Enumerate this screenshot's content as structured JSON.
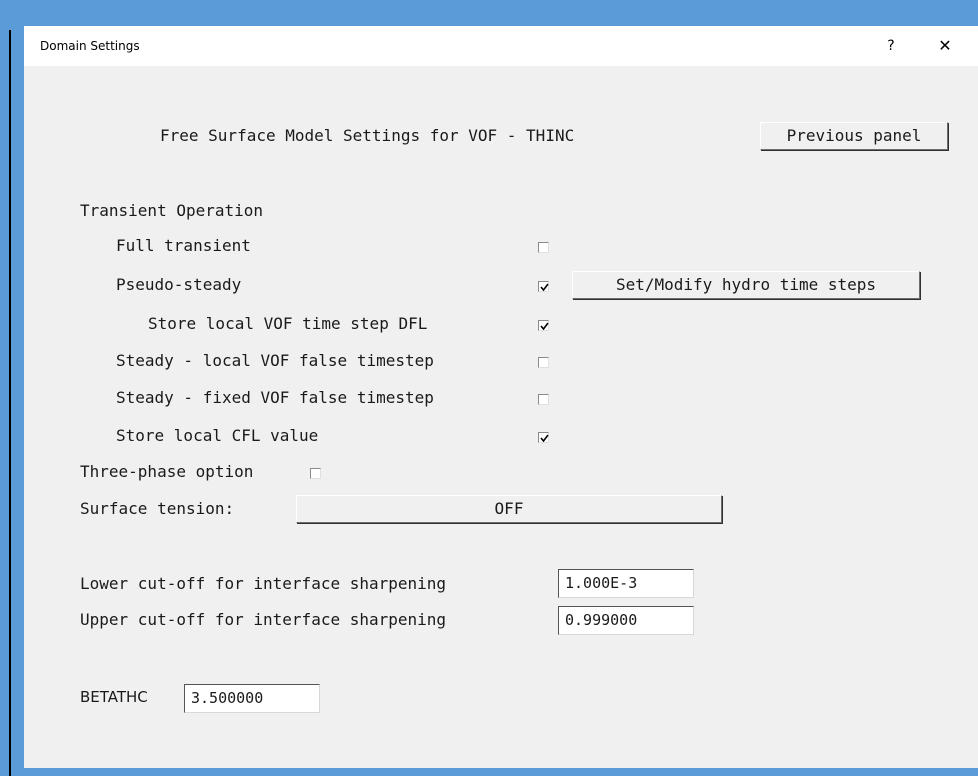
{
  "window": {
    "title": "Domain Settings",
    "help_label": "?",
    "close_label": "✕"
  },
  "panel": {
    "heading": "Free Surface Model Settings for VOF - THINC",
    "previous_button": "Previous panel"
  },
  "transient": {
    "section_label": "Transient Operation",
    "options": [
      {
        "label": "Full transient",
        "checked": false
      },
      {
        "label": "Pseudo-steady",
        "checked": true
      },
      {
        "label": "Store local VOF time step DFL",
        "checked": true
      },
      {
        "label": "Steady - local VOF false timestep",
        "checked": false
      },
      {
        "label": "Steady - fixed VOF false timestep",
        "checked": false
      },
      {
        "label": "Store local CFL value",
        "checked": true
      }
    ],
    "hydro_button": "Set/Modify hydro time steps"
  },
  "three_phase": {
    "label": "Three-phase option",
    "checked": false
  },
  "surface_tension": {
    "label": "Surface tension:",
    "value": "OFF"
  },
  "sharpening": {
    "lower_label": "Lower cut-off for interface sharpening",
    "lower_value": "1.000E-3",
    "upper_label": "Upper cut-off for interface sharpening",
    "upper_value": "0.999000"
  },
  "betathc": {
    "label": "BETATHC",
    "value": "3.500000"
  }
}
